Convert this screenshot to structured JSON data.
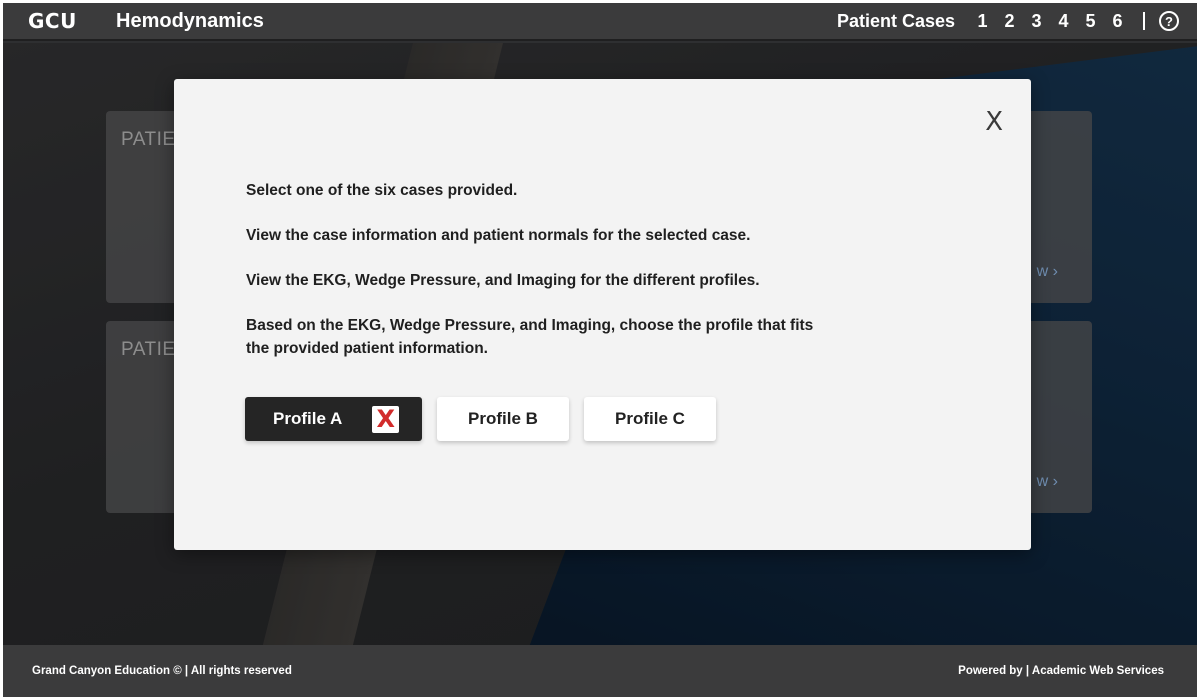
{
  "header": {
    "logo": "GCU",
    "title": "Hemodynamics",
    "nav_label": "Patient Cases",
    "cases": [
      "1",
      "2",
      "3",
      "4",
      "5",
      "6"
    ],
    "help_glyph": "?"
  },
  "background_cards": [
    {
      "title": "PATIE",
      "view": "w ›"
    },
    {
      "title": "PATIE",
      "view": "w ›"
    }
  ],
  "modal": {
    "close_glyph": "X",
    "instructions": [
      "Select one of the six cases provided.",
      "View the case information and patient normals for the selected case.",
      "View the EKG, Wedge Pressure, and Imaging for the different profiles.",
      "Based on the EKG, Wedge Pressure, and Imaging, choose the profile that fits the provided patient information."
    ],
    "profiles": [
      {
        "label": "Profile A",
        "selected": true,
        "mark": "X"
      },
      {
        "label": "Profile B",
        "selected": false
      },
      {
        "label": "Profile C",
        "selected": false
      }
    ]
  },
  "footer": {
    "left": "Grand Canyon Education © | All rights reserved",
    "right": "Powered by | Academic Web Services"
  },
  "colors": {
    "header_bg": "#3b3b3c",
    "modal_bg": "#f3f3f3",
    "selected_profile_bg": "#252525",
    "wrong_mark": "#d22b2b"
  },
  "icons": {
    "help": "help-icon",
    "close": "close-icon",
    "wrong": "x-mark-icon",
    "view": "chevron-right-icon"
  }
}
